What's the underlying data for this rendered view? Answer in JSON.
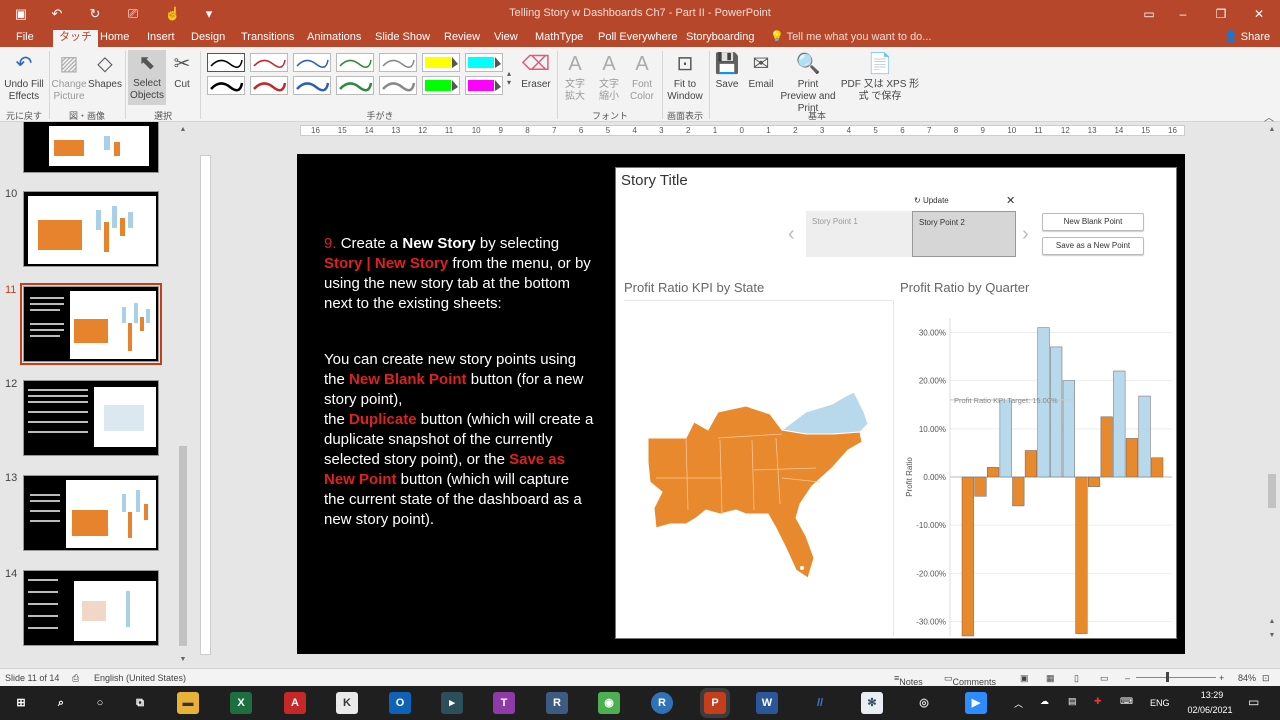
{
  "window": {
    "title": "Telling Story w Dashboards Ch7 - Part II  -  PowerPoint",
    "share_label": "Share"
  },
  "tabs": [
    {
      "label": "File"
    },
    {
      "label": "タッチ"
    },
    {
      "label": "Home"
    },
    {
      "label": "Insert"
    },
    {
      "label": "Design"
    },
    {
      "label": "Transitions"
    },
    {
      "label": "Animations"
    },
    {
      "label": "Slide Show"
    },
    {
      "label": "Review"
    },
    {
      "label": "View"
    },
    {
      "label": "MathType"
    },
    {
      "label": "Poll Everywhere"
    },
    {
      "label": "Storyboarding"
    }
  ],
  "tell_me": "Tell me what you want to do...",
  "ribbon": {
    "undo": "Undo Fill Effects",
    "change_picture": "Change Picture",
    "shapes": "Shapes",
    "select_objects": "Select Objects",
    "cut": "Cut",
    "eraser": "Eraser",
    "font_bigger": "文字 拡大",
    "font_smaller": "文字 縮小",
    "font_color": "Font Color",
    "fit_window": "Fit to Window",
    "save": "Save",
    "email": "Email",
    "print_preview": "Print Preview and Print",
    "pdf_xps": "PDF 又は XPS 形式 で保存",
    "groups": {
      "undo": "元に戻す",
      "shapes": "図・画像",
      "select": "選択",
      "pens": "手がき",
      "font": "フォント",
      "display": "画面表示",
      "basic": "基本"
    }
  },
  "thumbnails": [
    {
      "num": "10"
    },
    {
      "num": "11"
    },
    {
      "num": "12"
    },
    {
      "num": "13"
    },
    {
      "num": "14"
    }
  ],
  "ruler_labels": [
    "16",
    "15",
    "14",
    "13",
    "12",
    "11",
    "10",
    "9",
    "8",
    "7",
    "6",
    "5",
    "4",
    "3",
    "2",
    "1",
    "0",
    "1",
    "2",
    "3",
    "4",
    "5",
    "6",
    "7",
    "8",
    "9",
    "10",
    "11",
    "12",
    "13",
    "14",
    "15",
    "16"
  ],
  "slide": {
    "num": "9.",
    "p1_a": "Create a ",
    "p1_b": "New Story",
    "p1_c": " by selecting ",
    "p1_d": "Story | New Story",
    "p1_e": " from the menu, or by using the new story tab at the bottom next to the existing sheets:",
    "p2_a": "You can create new story points using the ",
    "p2_b": "New Blank Point",
    "p2_c": " button (for a new story point),",
    "p2_d": "the ",
    "p2_e": "Duplicate",
    "p2_f": " button (which will create a duplicate snapshot of the currently selected story point), or the ",
    "p2_g": "Save as New Point",
    "p2_h": " button (which will capture the current state of the dashboard as a new story point)."
  },
  "dashboard": {
    "story_title": "Story Title",
    "update": "Update",
    "story_point_1": "Story Point 1",
    "story_point_2": "Story Point 2",
    "new_blank_point": "New Blank Point",
    "save_new_point": "Save as a New Point",
    "map_title": "Profit Ratio KPI by State",
    "chart_title": "Profit Ratio by Quarter"
  },
  "chart_data": {
    "type": "bar",
    "ylabel": "Profit Ratio",
    "ylim": [
      -0.33,
      0.33
    ],
    "yticks": [
      "30.00%",
      "20.00%",
      "10.00%",
      "0.00%",
      "-10.00%",
      "-20.00%",
      "-30.00%"
    ],
    "ytick_values": [
      0.3,
      0.2,
      0.1,
      0,
      -0.1,
      -0.2,
      -0.3
    ],
    "reference_line": {
      "label": "Profit Ratio KPI Target: 15.00%",
      "value": 0.16
    },
    "series": [
      {
        "values": [
          -0.33,
          -0.04,
          0.02,
          0.16,
          -0.06,
          0.055,
          0.31,
          0.27,
          0.2,
          -0.325,
          -0.02,
          0.125,
          0.22,
          0.08,
          0.168,
          0.04
        ]
      }
    ],
    "colors": [
      "#e8892d",
      "#e8892d",
      "#e8892d",
      "#b8d9ec",
      "#e8892d",
      "#e8892d",
      "#b8d9ec",
      "#b8d9ec",
      "#b8d9ec",
      "#e8892d",
      "#e8892d",
      "#e8892d",
      "#b8d9ec",
      "#e8892d",
      "#b8d9ec",
      "#e8892d"
    ]
  },
  "status": {
    "slide_info": "Slide 11 of 14",
    "language": "English (United States)",
    "notes": "Notes",
    "comments": "Comments",
    "zoom": "84%"
  },
  "taskbar": {
    "lang": "ENG",
    "time": "13:29",
    "date": "02/06/2021"
  }
}
